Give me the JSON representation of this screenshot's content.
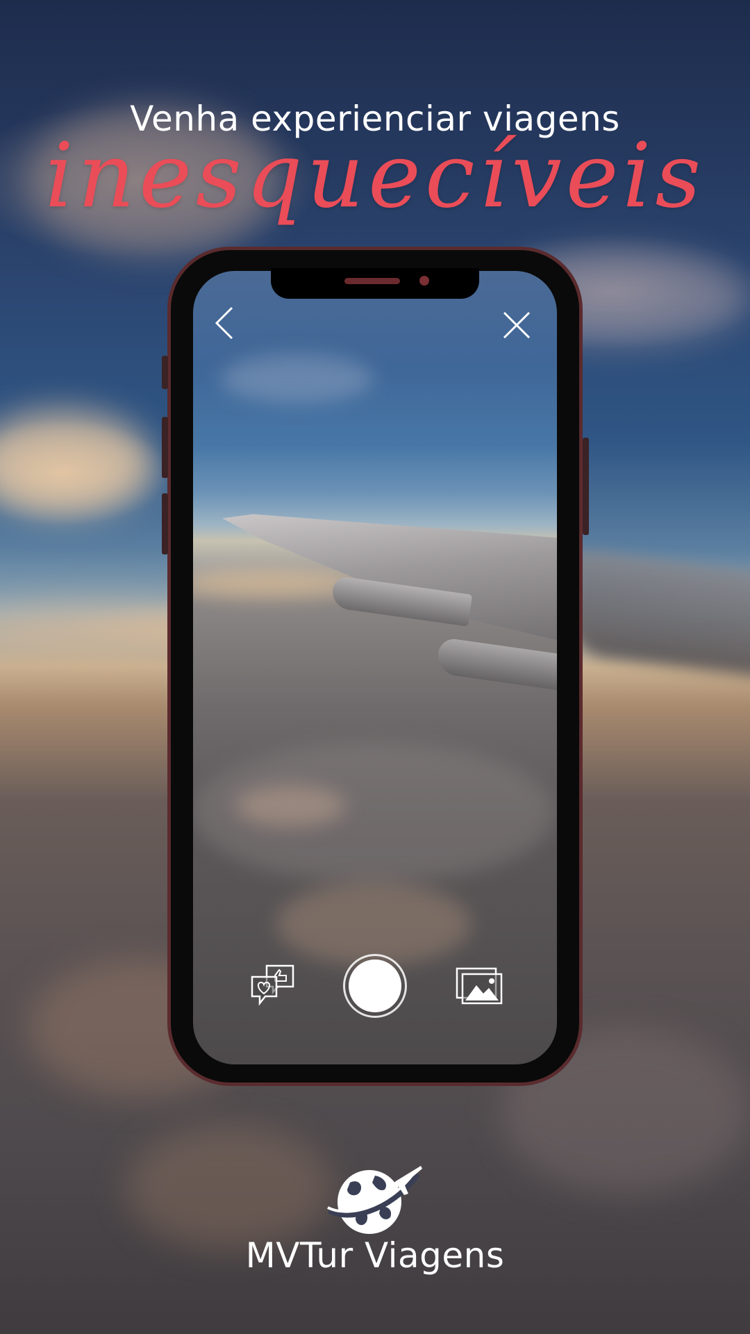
{
  "headline": "Venha experienciar viagens",
  "script_word": "inesquecíveis",
  "brand": "MVTur Viagens",
  "icons": {
    "back": "chevron-left-icon",
    "close": "close-icon",
    "social": "social-reactions-icon",
    "shutter": "shutter-button",
    "gallery": "gallery-icon",
    "logo": "globe-airplane-logo"
  },
  "colors": {
    "accent": "#ea4d58",
    "text": "#ffffff",
    "phone_frame": "#5a2b2e"
  }
}
